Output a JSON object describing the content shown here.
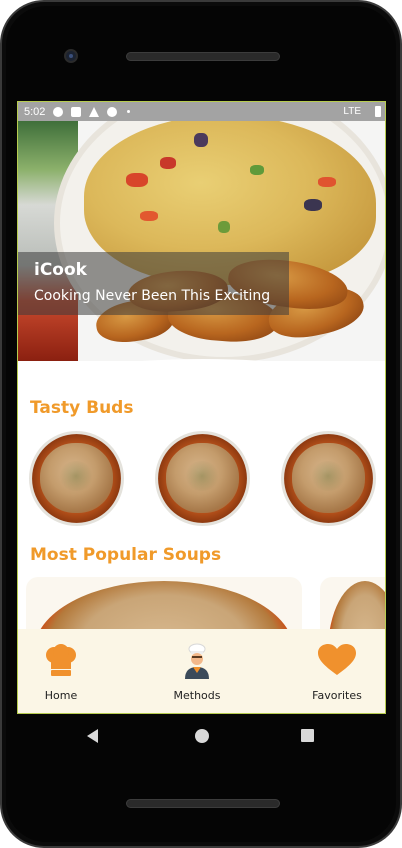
{
  "statusbar": {
    "time": "5:02",
    "network": "LTE",
    "icons": [
      "settings-icon",
      "gmail-icon",
      "alert-icon",
      "sync-icon",
      "dot-icon",
      "battery-icon"
    ]
  },
  "hero": {
    "title": "iCook",
    "subtitle": "Cooking Never Been This Exciting"
  },
  "sections": {
    "tasty_buds": {
      "title": "Tasty Buds",
      "item_count": 3
    },
    "popular_soups": {
      "title": "Most Popular Soups"
    }
  },
  "bottom_nav": {
    "items": [
      {
        "label": "Home",
        "icon": "chef-hat-icon"
      },
      {
        "label": "Methods",
        "icon": "chef-person-icon"
      },
      {
        "label": "Favorites",
        "icon": "heart-icon"
      }
    ]
  },
  "colors": {
    "accent": "#f09a2a",
    "nav_bg": "#fbf6e6",
    "icon_orange": "#f0912d"
  },
  "system_nav": {
    "icons": [
      "back-icon",
      "home-icon",
      "recents-icon"
    ]
  }
}
